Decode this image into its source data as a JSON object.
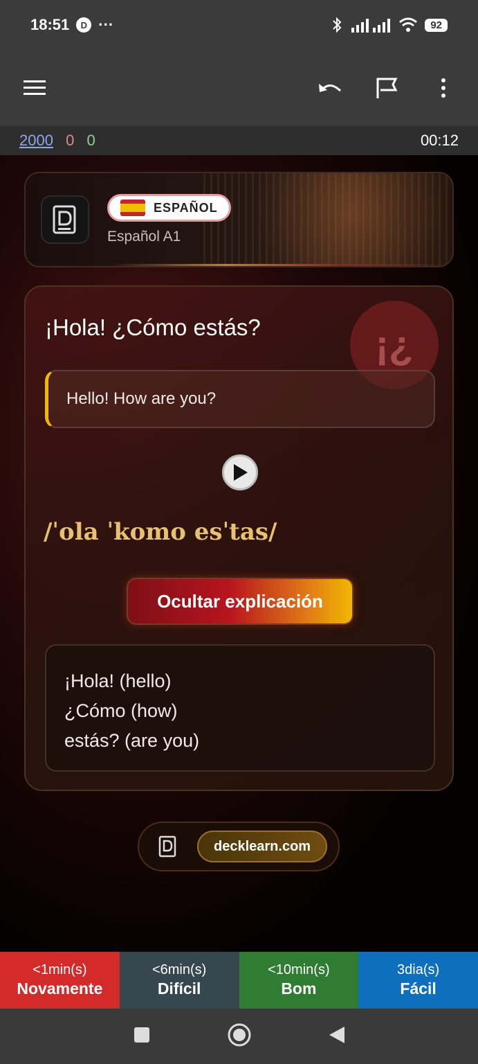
{
  "status_bar": {
    "time": "18:51",
    "dots": "···",
    "battery": "92"
  },
  "counts": {
    "new": "2000",
    "learning": "0",
    "review": "0",
    "timer": "00:12"
  },
  "header": {
    "language": "ESPAÑOL",
    "deck": "Español A1"
  },
  "card": {
    "sentence": "¡Hola! ¿Cómo estás?",
    "translation": "Hello! How are you?",
    "ipa": "/ˈola ˈkomo esˈtas/",
    "toggle_label": "Ocultar explicación",
    "explanation": [
      "¡Hola! (hello)",
      "¿Cómo (how)",
      "estás? (are you)"
    ],
    "bubble_glyph": "¡¿"
  },
  "footer": {
    "site": "decklearn.com"
  },
  "answers": [
    {
      "time": "<1min(s)",
      "label": "Novamente",
      "color": "#d32a2a"
    },
    {
      "time": "<6min(s)",
      "label": "Difícil",
      "color": "#37474f"
    },
    {
      "time": "<10min(s)",
      "label": "Bom",
      "color": "#2e7d32"
    },
    {
      "time": "3dia(s)",
      "label": "Fácil",
      "color": "#0f6fbf"
    }
  ],
  "icons": [
    "menu-icon",
    "undo-icon",
    "flag-icon",
    "more-vert-icon",
    "play-icon",
    "deck-logo-icon",
    "square-nav-icon",
    "home-nav-icon",
    "back-nav-icon"
  ]
}
